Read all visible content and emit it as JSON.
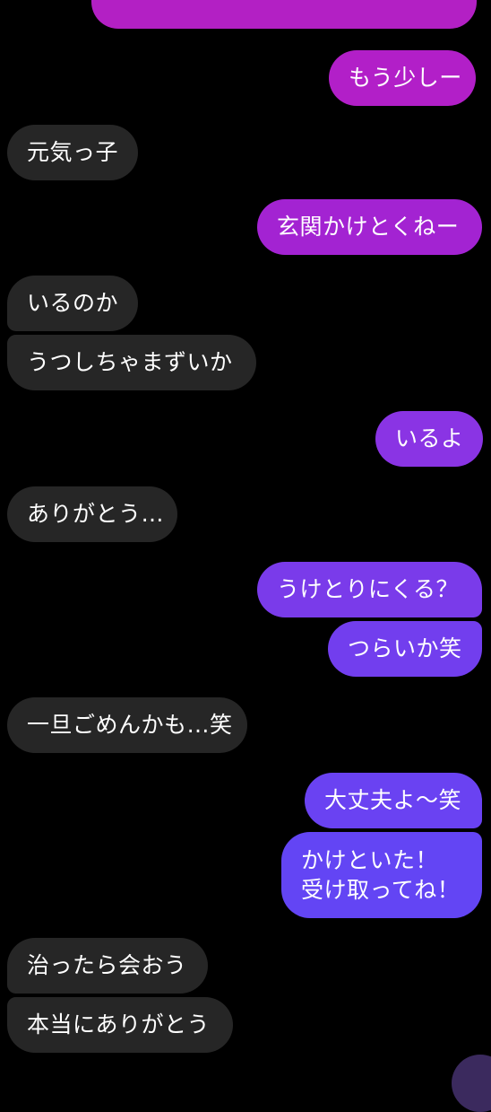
{
  "conversation": {
    "messages": [
      {
        "side": "out",
        "text": "もう少しー",
        "color": "#b21fc8"
      },
      {
        "side": "in",
        "text": "元気っ子",
        "color": "#262626"
      },
      {
        "side": "out",
        "text": "玄関かけとくねー",
        "color": "#a323d2"
      },
      {
        "side": "in",
        "text": "いるのか",
        "color": "#262626"
      },
      {
        "side": "in",
        "text": "うつしちゃまずいか",
        "color": "#262626"
      },
      {
        "side": "out",
        "text": "いるよ",
        "color": "#8a34e4"
      },
      {
        "side": "in",
        "text": "ありがとう…",
        "color": "#262626"
      },
      {
        "side": "out",
        "text": "うけとりにくる？",
        "color": "#7a3bea"
      },
      {
        "side": "out",
        "text": "つらいか笑",
        "color": "#723eee"
      },
      {
        "side": "in",
        "text": "一旦ごめんかも…笑",
        "color": "#262626"
      },
      {
        "side": "out",
        "text": "大丈夫よ〜笑",
        "color": "#6a42f2"
      },
      {
        "side": "out",
        "lines": [
          "かけといた！",
          "受け取ってね！"
        ],
        "color": "#6345f4"
      },
      {
        "side": "in",
        "text": "治ったら会おう",
        "color": "#262626"
      },
      {
        "side": "in",
        "text": "本当にありがとう",
        "color": "#262626"
      }
    ]
  },
  "colors": {
    "background": "#000000",
    "incoming_bubble": "#262626",
    "outgoing_gradient_top": "#b320c4",
    "outgoing_gradient_bottom": "#6345f4",
    "text": "#ffffff"
  }
}
